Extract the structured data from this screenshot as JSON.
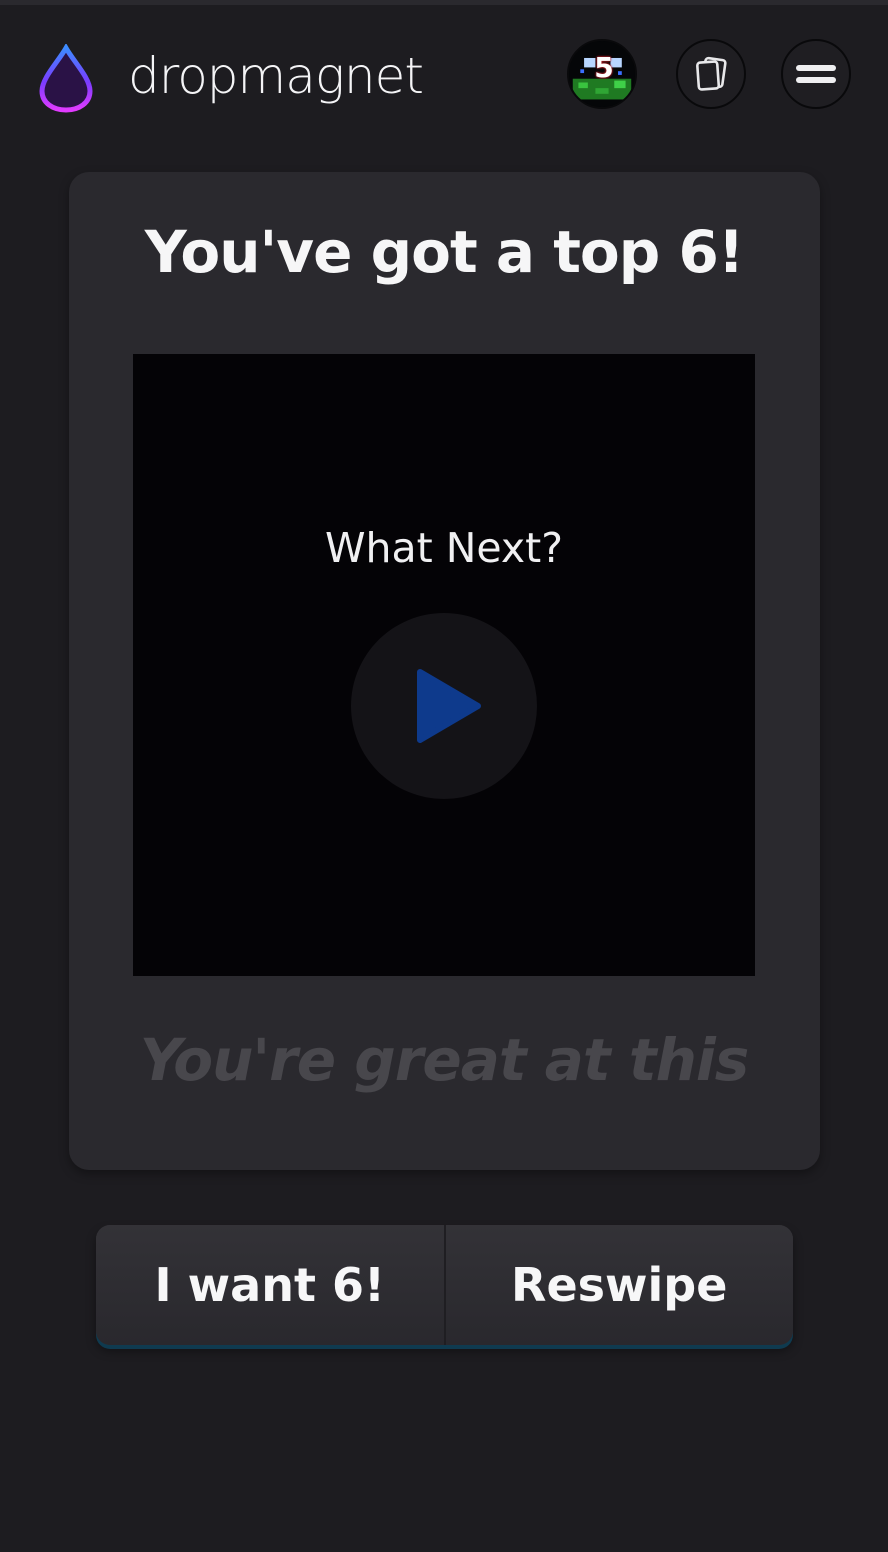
{
  "header": {
    "brand": "dropmagnet",
    "avatar_badge": "5",
    "icons": [
      "drop-logo-icon",
      "avatar-icon",
      "cards-icon",
      "menu-icon"
    ]
  },
  "card": {
    "title": "You've got a top 6!",
    "video_caption": "What Next?",
    "tagline": "You're great at this"
  },
  "actions": {
    "primary_label": "I want 6!",
    "secondary_label": "Reswipe"
  },
  "colors": {
    "background": "#1d1c20",
    "card": "#2a292e",
    "accent_drop_start": "#3d8bff",
    "accent_drop_end": "#c13bff",
    "play_triangle": "#0e3a8c",
    "button_underline": "#0f3a4f"
  }
}
